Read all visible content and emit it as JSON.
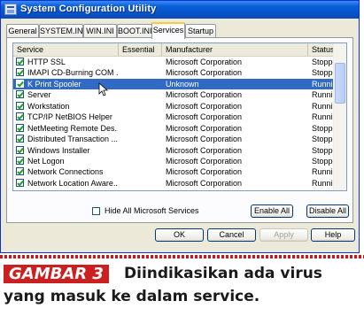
{
  "window": {
    "title": "System Configuration Utility",
    "icon": "msconfig-icon"
  },
  "tabs": [
    {
      "label": "General"
    },
    {
      "label": "SYSTEM.INI"
    },
    {
      "label": "WIN.INI"
    },
    {
      "label": "BOOT.INI"
    },
    {
      "label": "Services",
      "active": true
    },
    {
      "label": "Startup"
    }
  ],
  "columns": [
    "Service",
    "Essential",
    "Manufacturer",
    "Status"
  ],
  "services": [
    {
      "name": "HTTP SSL",
      "essential": "",
      "manufacturer": "Microsoft Corporation",
      "status": "Stopped",
      "checked": true
    },
    {
      "name": "IMAPI CD-Burning COM ...",
      "essential": "",
      "manufacturer": "Microsoft Corporation",
      "status": "Stopped",
      "checked": true
    },
    {
      "name": "K Print Spooler",
      "essential": "",
      "manufacturer": "Unknown",
      "status": "Running",
      "checked": true,
      "selected": true
    },
    {
      "name": "Server",
      "essential": "",
      "manufacturer": "Microsoft Corporation",
      "status": "Running",
      "checked": true
    },
    {
      "name": "Workstation",
      "essential": "",
      "manufacturer": "Microsoft Corporation",
      "status": "Running",
      "checked": true
    },
    {
      "name": "TCP/IP NetBIOS Helper",
      "essential": "",
      "manufacturer": "Microsoft Corporation",
      "status": "Running",
      "checked": true
    },
    {
      "name": "NetMeeting Remote Des...",
      "essential": "",
      "manufacturer": "Microsoft Corporation",
      "status": "Stopped",
      "checked": true
    },
    {
      "name": "Distributed Transaction ...",
      "essential": "",
      "manufacturer": "Microsoft Corporation",
      "status": "Stopped",
      "checked": true
    },
    {
      "name": "Windows Installer",
      "essential": "",
      "manufacturer": "Microsoft Corporation",
      "status": "Stopped",
      "checked": true
    },
    {
      "name": "Net Logon",
      "essential": "",
      "manufacturer": "Microsoft Corporation",
      "status": "Stopped",
      "checked": true
    },
    {
      "name": "Network Connections",
      "essential": "",
      "manufacturer": "Microsoft Corporation",
      "status": "Running",
      "checked": true
    },
    {
      "name": "Network Location Aware...",
      "essential": "",
      "manufacturer": "Microsoft Corporation",
      "status": "Running",
      "checked": true
    }
  ],
  "hide_ms_label": "Hide All Microsoft Services",
  "enable_all_label": "Enable All",
  "disable_all_label": "Disable All",
  "ok_label": "OK",
  "cancel_label": "Cancel",
  "apply_label": "Apply",
  "help_label": "Help",
  "caption": {
    "tag": "GAMBAR 3",
    "line1": "Diindikasikan ada virus",
    "line2": "yang masuk ke dalam service."
  },
  "colors": {
    "selection": "#316ac5",
    "caption_red": "#cc1f1f",
    "titlebar": "#0653c8"
  }
}
